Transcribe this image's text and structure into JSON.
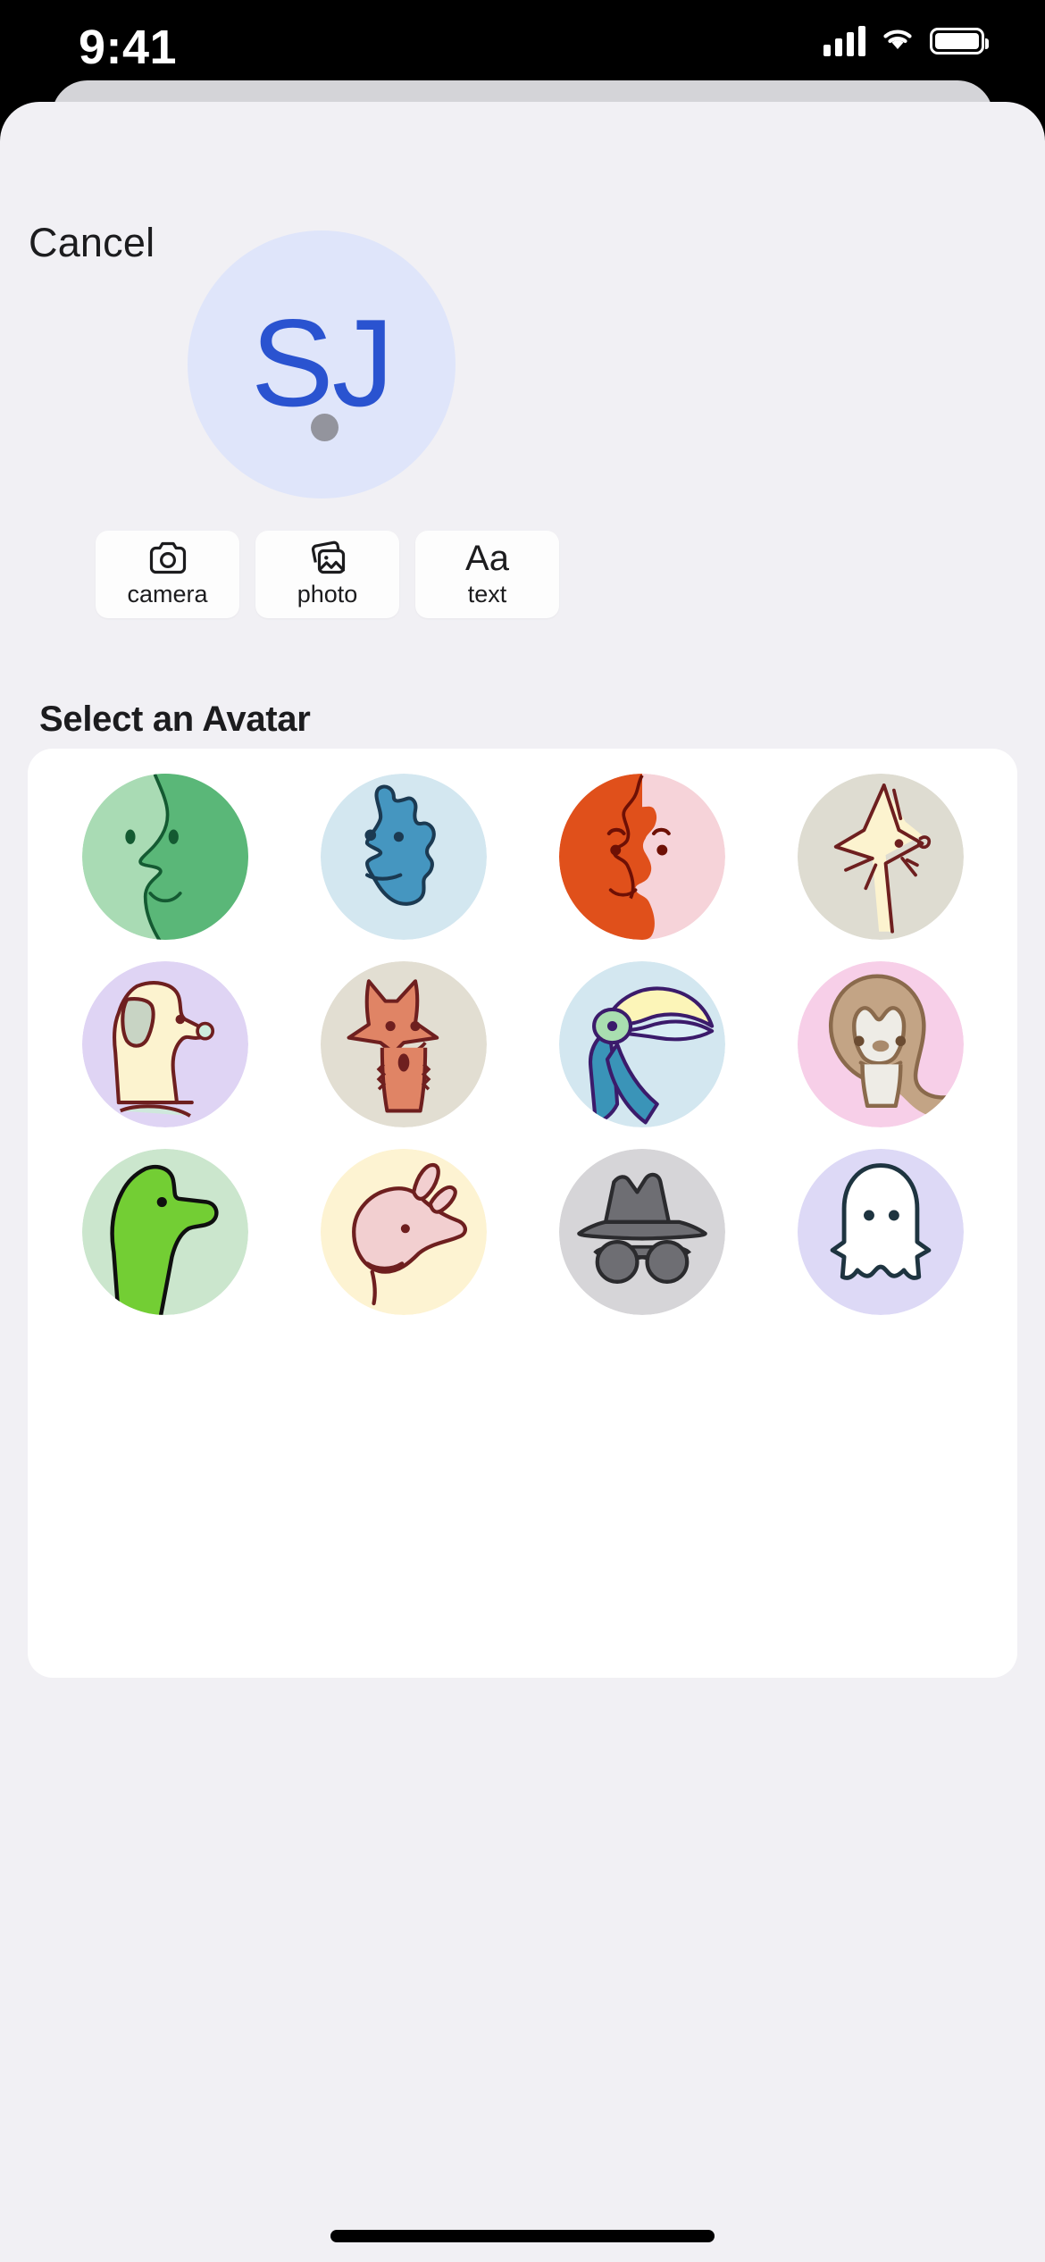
{
  "status_bar": {
    "time": "9:41",
    "icons": [
      "cellular-signal-icon",
      "wifi-icon",
      "battery-icon"
    ]
  },
  "sheet": {
    "cancel_label": "Cancel"
  },
  "current_avatar": {
    "initials": "SJ",
    "background_color": "#dfe5fa",
    "text_color": "#2a53d0",
    "indicator_dot_color": "#93949d"
  },
  "actions": [
    {
      "id": "camera",
      "label": "camera",
      "icon": "camera-icon"
    },
    {
      "id": "photo",
      "label": "photo",
      "icon": "photo-library-icon"
    },
    {
      "id": "text",
      "label": "text",
      "icon": "Aa"
    }
  ],
  "avatar_section": {
    "title": "Select an Avatar",
    "avatars": [
      {
        "id": "green-face",
        "name": "green-split-face-avatar",
        "bg": "#a9dbb4",
        "accent": "#5ab778"
      },
      {
        "id": "blue-face",
        "name": "blue-wavy-face-avatar",
        "bg": "#d3e7f0",
        "accent": "#4596c0"
      },
      {
        "id": "orange-face",
        "name": "orange-pink-face-avatar",
        "bg": "#e0501b",
        "accent": "#f6d3d9"
      },
      {
        "id": "cream-bird",
        "name": "cream-crane-bird-avatar",
        "bg": "#dedcd1",
        "accent": "#fcf3cf"
      },
      {
        "id": "cream-dog",
        "name": "cream-dog-avatar",
        "bg": "#dfd4f4",
        "accent": "#fcf3cf"
      },
      {
        "id": "fox",
        "name": "fox-avatar",
        "bg": "#e2ded2",
        "accent": "#e08465"
      },
      {
        "id": "toucan",
        "name": "toucan-avatar",
        "bg": "#d3e7f0",
        "accent": "#3a94b8"
      },
      {
        "id": "sloth",
        "name": "sloth-avatar",
        "bg": "#f7cfe8",
        "accent": "#c3a485"
      },
      {
        "id": "green-dino",
        "name": "green-dinosaur-avatar",
        "bg": "#cbe6cd",
        "accent": "#73ce34"
      },
      {
        "id": "pink-pig",
        "name": "pink-pig-avatar",
        "bg": "#fdf3d2",
        "accent": "#f2cfd0"
      },
      {
        "id": "incognito",
        "name": "incognito-hat-glasses-avatar",
        "bg": "#d6d5d8",
        "accent": "#6e6e73"
      },
      {
        "id": "ghost",
        "name": "ghost-avatar",
        "bg": "#ddd9f6",
        "accent": "#ffffff"
      }
    ]
  }
}
